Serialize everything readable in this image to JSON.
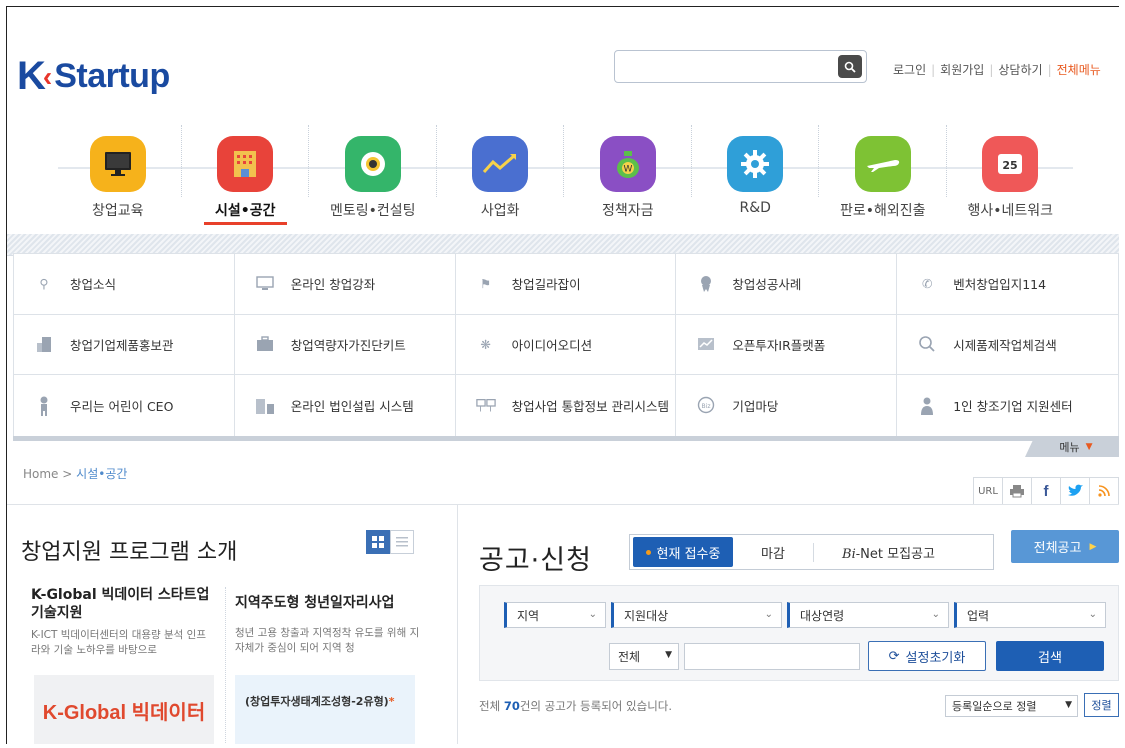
{
  "header": {
    "logo_k": "K",
    "logo_text": "Startup",
    "search": {
      "placeholder": "",
      "value": ""
    },
    "util_links": [
      "로그인",
      "회원가입",
      "상담하기",
      "전체메뉴"
    ]
  },
  "main_nav": [
    {
      "label": "창업교육",
      "icon": "monitor-icon",
      "color": "#f6b21b"
    },
    {
      "label": "시설•공간",
      "icon": "building-icon",
      "color": "#e8433a",
      "active": true
    },
    {
      "label": "멘토링•컨설팅",
      "icon": "eye-icon",
      "color": "#34b56a"
    },
    {
      "label": "사업화",
      "icon": "chart-icon",
      "color": "#4a6fd0"
    },
    {
      "label": "정책자금",
      "icon": "money-bag-icon",
      "color": "#8a4fc4"
    },
    {
      "label": "R&D",
      "icon": "gear-icon",
      "color": "#2f9fd8"
    },
    {
      "label": "판로•해외진출",
      "icon": "airplane-icon",
      "color": "#7ec234"
    },
    {
      "label": "행사•네트워크",
      "icon": "calendar-icon",
      "color": "#ef5858"
    }
  ],
  "quick_menu": [
    "창업소식",
    "온라인 창업강좌",
    "창업길라잡이",
    "창업성공사례",
    "벤처창업입지114",
    "창업기업제품홍보관",
    "창업역량자가진단키트",
    "아이디어오디션",
    "오픈투자IR플랫폼",
    "시제품제작업체검색",
    "우리는 어린이 CEO",
    "온라인 법인설립 시스템",
    "창업사업 통합정보 관리시스템",
    "기업마당",
    "1인 창조기업 지원센터"
  ],
  "menu_tab": "메뉴",
  "breadcrumb": {
    "home": "Home",
    "sep": ">",
    "current": "시설•공간"
  },
  "share": {
    "url": "URL"
  },
  "program": {
    "title": "창업지원 프로그램 소개",
    "cards": [
      {
        "title": "K-Global 빅데이터 스타트업 기술지원",
        "desc": "K-ICT 빅데이터센터의 대용량 분석 인프라와 기술 노하우를 바탕으로"
      },
      {
        "title": "지역주도형 청년일자리사업",
        "desc": "청년 고용 창출과 지역정착 유도를 위해 지자체가 중심이 되어 지역 청"
      }
    ],
    "banner1": "K-Global 빅데이터",
    "banner2": "(창업투자생태계조성형-2유형)",
    "banner2_mark": "*"
  },
  "announce": {
    "title": "공고·신청",
    "tabs": [
      "현재 접수중",
      "마감",
      "Net 모집공고"
    ],
    "tab3_prefix": "Bi-",
    "all_button": "전체공고",
    "filters": [
      "지역",
      "지원대상",
      "대상연령",
      "업력"
    ],
    "scope": "전체",
    "keyword": "",
    "reset_button": "설정초기화",
    "search_button": "검색",
    "count_prefix": "전체 ",
    "count": "70",
    "count_suffix": "건의 공고가 등록되어 있습니다.",
    "sort_option": "등록일순으로 정렬",
    "sort_button": "정렬"
  }
}
